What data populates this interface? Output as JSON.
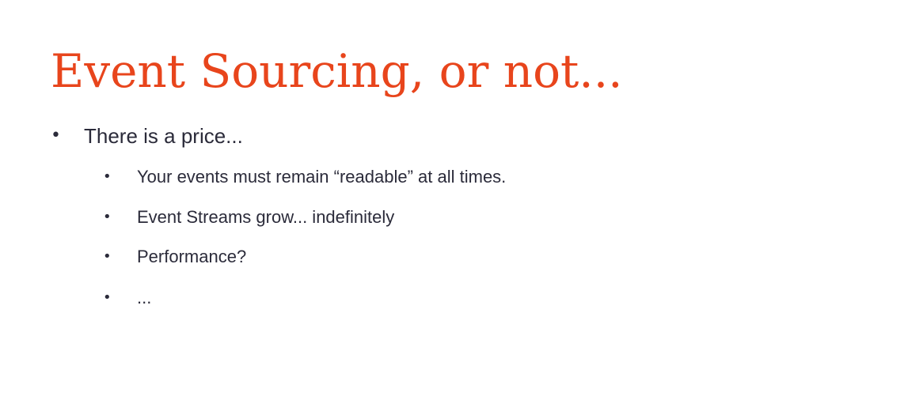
{
  "slide": {
    "title": "Event Sourcing, or not...",
    "accent_color": "#e8451c",
    "text_color": "#2b2b3a",
    "bullet_glyph": "•",
    "bullets": [
      {
        "text": "There is a price...",
        "children": [
          {
            "text": "Your events must remain “readable” at all times."
          },
          {
            "text": "Event Streams grow... indefinitely"
          },
          {
            "text": "Performance?"
          },
          {
            "text": "..."
          }
        ]
      }
    ]
  }
}
